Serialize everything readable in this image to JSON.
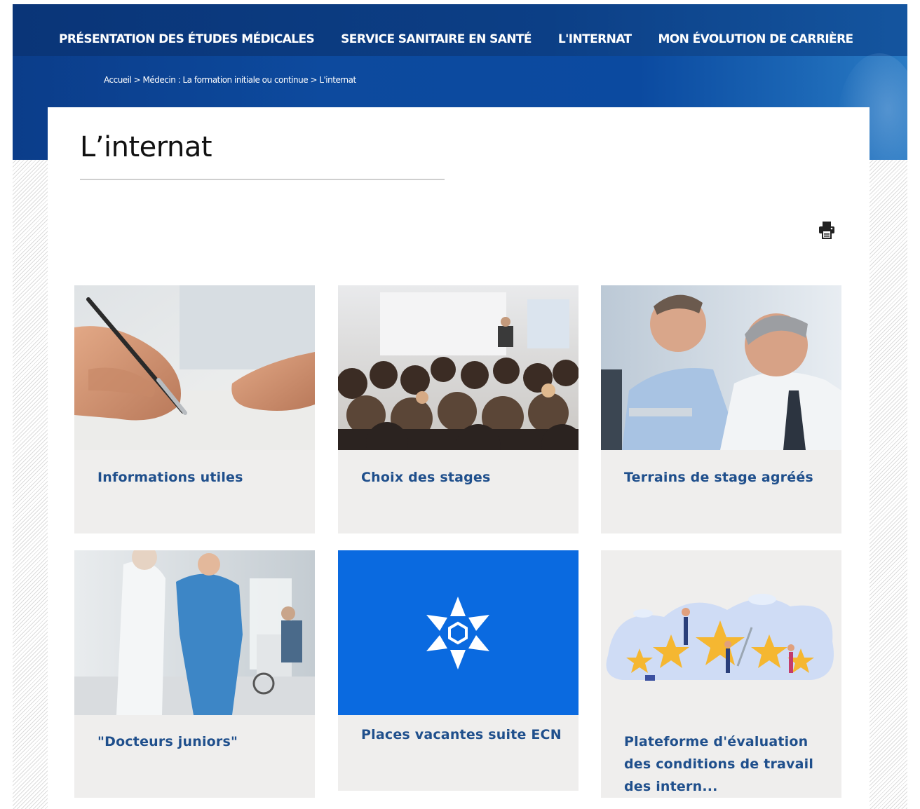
{
  "nav": {
    "items": [
      {
        "label": "PRÉSENTATION DES ÉTUDES MÉDICALES"
      },
      {
        "label": "SERVICE SANITAIRE EN SANTÉ"
      },
      {
        "label": "L'INTERNAT"
      },
      {
        "label": "MON ÉVOLUTION DE CARRIÈRE"
      }
    ]
  },
  "breadcrumb": {
    "home": "Accueil",
    "separator": " > ",
    "section": "Médecin : La formation initiale ou continue",
    "current": "L'internat"
  },
  "page": {
    "title": "L’internat",
    "print_icon": "printer-icon"
  },
  "cards": [
    {
      "label": "Informations utiles",
      "image": "hand-writing-photo"
    },
    {
      "label": "Choix des stages",
      "image": "conference-audience-photo"
    },
    {
      "label": "Terrains de stage agréés",
      "image": "doctors-at-computer-photo"
    },
    {
      "label": "\"Docteurs juniors\"",
      "image": "hospital-corridor-photo"
    },
    {
      "label": "Places vacantes suite ECN",
      "image": "star-logo-on-blue"
    },
    {
      "label": "Plateforme d'évaluation des conditions de travail des intern...",
      "image": "rating-stars-illustration"
    }
  ],
  "colors": {
    "header_blue": "#0c3f86",
    "card_bg": "#efeeed",
    "card_text": "#1f4f8c",
    "ecn_blue": "#0a6ae0"
  }
}
